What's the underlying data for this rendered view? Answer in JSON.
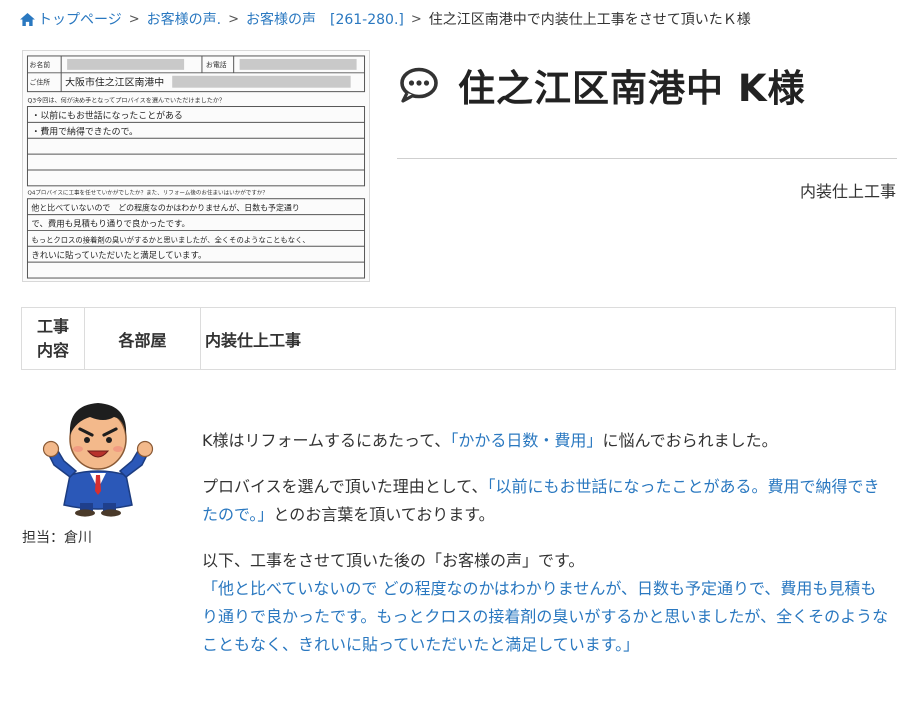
{
  "breadcrumb": {
    "home": "トップページ",
    "separator": ">",
    "level1": "お客様の声.",
    "level2": "お客様の声　[261-280.]",
    "current": "住之江区南港中で内装仕上工事をさせて頂いたＫ様"
  },
  "survey": {
    "name_label": "お名前",
    "phone_label": "お電話",
    "address_label": "ご住所",
    "address_value": "大阪市住之江区南港中",
    "q3": "Q3今回は、何が決め手となってプロバイスを選んでいただけましたか？",
    "q3_answer_1": "・以前にもお世話になったことがある",
    "q3_answer_2": "・費用で納得できたので。",
    "q4": "Q4プロバイスに工事を任せていかがでしたか？また、リフォーム後のお住まいはいかがですか？",
    "q4_answer_1": "他と比べていないので　どの程度なのかはわかりませんが、日数も予定通り",
    "q4_answer_2": "で、費用も見積もり通りで良かったです。",
    "q4_answer_3": "もっとクロスの接着剤の臭いがするかと思いましたが、全くそのようなこともなく、",
    "q4_answer_4": "きれいに貼っていただいたと満足しています。"
  },
  "title": "住之江区南港中 K様",
  "category": "内装仕上工事",
  "work_table": {
    "header_line1": "工事",
    "header_line2": "内容",
    "room": "各部屋",
    "work": "内装仕上工事"
  },
  "staff": {
    "label": "担当：倉川"
  },
  "content": {
    "p1_before": "K様はリフォームするにあたって、",
    "p1_highlight": "「かかる日数・費用」",
    "p1_after": "に悩んでおられました。",
    "p2_before": "プロバイスを選んで頂いた理由として、",
    "p2_highlight": "「以前にもお世話になったことがある。費用で納得できたので。」",
    "p2_after": "とのお言葉を頂いております。",
    "p3_intro": "以下、工事をさせて頂いた後の「お客様の声」です。",
    "p3_quote": "「他と比べていないので どの程度なのかはわかりませんが、日数も予定通りで、費用も見積もり通りで良かったです。もっとクロスの接着剤の臭いがするかと思いましたが、全くそのようなこともなく、きれいに貼っていただいたと満足しています。」"
  },
  "colors": {
    "link": "#2a78c0",
    "text": "#333333",
    "title": "#222222"
  },
  "icons": [
    "home-icon",
    "speech-bubble-icon",
    "staff-avatar"
  ]
}
